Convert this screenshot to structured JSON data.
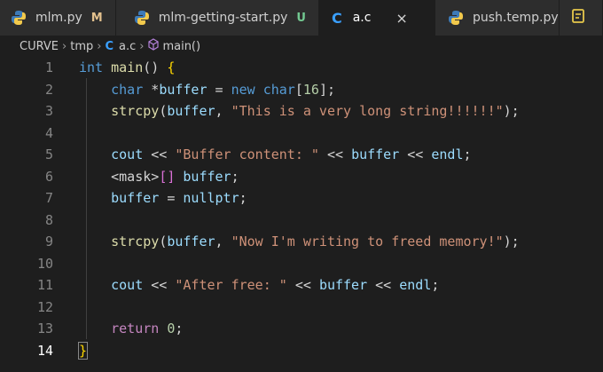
{
  "tabs": [
    {
      "label": "mlm.py",
      "badge": "M",
      "badge_color": "#e2c08d",
      "icon": "python-icon"
    },
    {
      "label": "mlm-getting-start.py",
      "badge": "U",
      "badge_color": "#73c991",
      "icon": "python-icon"
    },
    {
      "label": "a.c",
      "icon": "c-icon",
      "active": true,
      "close": "×"
    },
    {
      "label": "push.temp.py",
      "icon": "python-icon"
    },
    {
      "label": "",
      "icon": "json-icon"
    }
  ],
  "breadcrumb": {
    "root": "CURVE",
    "folder": "tmp",
    "file": "a.c",
    "symbol": "main()"
  },
  "editor": {
    "line_numbers": [
      "1",
      "2",
      "3",
      "4",
      "5",
      "6",
      "7",
      "8",
      "9",
      "10",
      "11",
      "12",
      "13",
      "14"
    ],
    "current_line": 14,
    "lines": [
      {
        "tokens": [
          {
            "t": "int",
            "c": "kw"
          },
          {
            "t": " "
          },
          {
            "t": "main",
            "c": "fn"
          },
          {
            "t": "() "
          },
          {
            "t": "{",
            "c": "br1"
          }
        ]
      },
      {
        "tokens": [
          {
            "t": "    "
          },
          {
            "t": "char",
            "c": "kw"
          },
          {
            "t": " *"
          },
          {
            "t": "buffer",
            "c": "var"
          },
          {
            "t": " = "
          },
          {
            "t": "new",
            "c": "kw"
          },
          {
            "t": " "
          },
          {
            "t": "char",
            "c": "kw"
          },
          {
            "t": "["
          },
          {
            "t": "16",
            "c": "num"
          },
          {
            "t": "];"
          }
        ]
      },
      {
        "tokens": [
          {
            "t": "    "
          },
          {
            "t": "strcpy",
            "c": "fn"
          },
          {
            "t": "("
          },
          {
            "t": "buffer",
            "c": "var"
          },
          {
            "t": ", "
          },
          {
            "t": "\"This is a very long string!!!!!!\"",
            "c": "str"
          },
          {
            "t": ");"
          }
        ]
      },
      {
        "tokens": []
      },
      {
        "tokens": [
          {
            "t": "    "
          },
          {
            "t": "cout",
            "c": "var"
          },
          {
            "t": " << "
          },
          {
            "t": "\"Buffer content: \"",
            "c": "str"
          },
          {
            "t": " << "
          },
          {
            "t": "buffer",
            "c": "var"
          },
          {
            "t": " << "
          },
          {
            "t": "endl",
            "c": "var"
          },
          {
            "t": ";"
          }
        ]
      },
      {
        "tokens": [
          {
            "t": "    <mask>"
          },
          {
            "t": "[]",
            "c": "br2"
          },
          {
            "t": " "
          },
          {
            "t": "buffer",
            "c": "var"
          },
          {
            "t": ";"
          }
        ]
      },
      {
        "tokens": [
          {
            "t": "    "
          },
          {
            "t": "buffer",
            "c": "var"
          },
          {
            "t": " = "
          },
          {
            "t": "nullptr",
            "c": "var"
          },
          {
            "t": ";"
          }
        ]
      },
      {
        "tokens": []
      },
      {
        "tokens": [
          {
            "t": "    "
          },
          {
            "t": "strcpy",
            "c": "fn"
          },
          {
            "t": "("
          },
          {
            "t": "buffer",
            "c": "var"
          },
          {
            "t": ", "
          },
          {
            "t": "\"Now I'm writing to freed memory!\"",
            "c": "str"
          },
          {
            "t": ");"
          }
        ]
      },
      {
        "tokens": []
      },
      {
        "tokens": [
          {
            "t": "    "
          },
          {
            "t": "cout",
            "c": "var"
          },
          {
            "t": " << "
          },
          {
            "t": "\"After free: \"",
            "c": "str"
          },
          {
            "t": " << "
          },
          {
            "t": "buffer",
            "c": "var"
          },
          {
            "t": " << "
          },
          {
            "t": "endl",
            "c": "var"
          },
          {
            "t": ";"
          }
        ]
      },
      {
        "tokens": []
      },
      {
        "tokens": [
          {
            "t": "    "
          },
          {
            "t": "return",
            "c": "ctl"
          },
          {
            "t": " "
          },
          {
            "t": "0",
            "c": "num"
          },
          {
            "t": ";"
          }
        ]
      },
      {
        "tokens": [
          {
            "t": "}",
            "c": "br1 brace-hl"
          }
        ]
      }
    ]
  },
  "colors": {
    "background": "#1e1e1e",
    "tabbar": "#252526",
    "accent": "#3aa0ff"
  }
}
